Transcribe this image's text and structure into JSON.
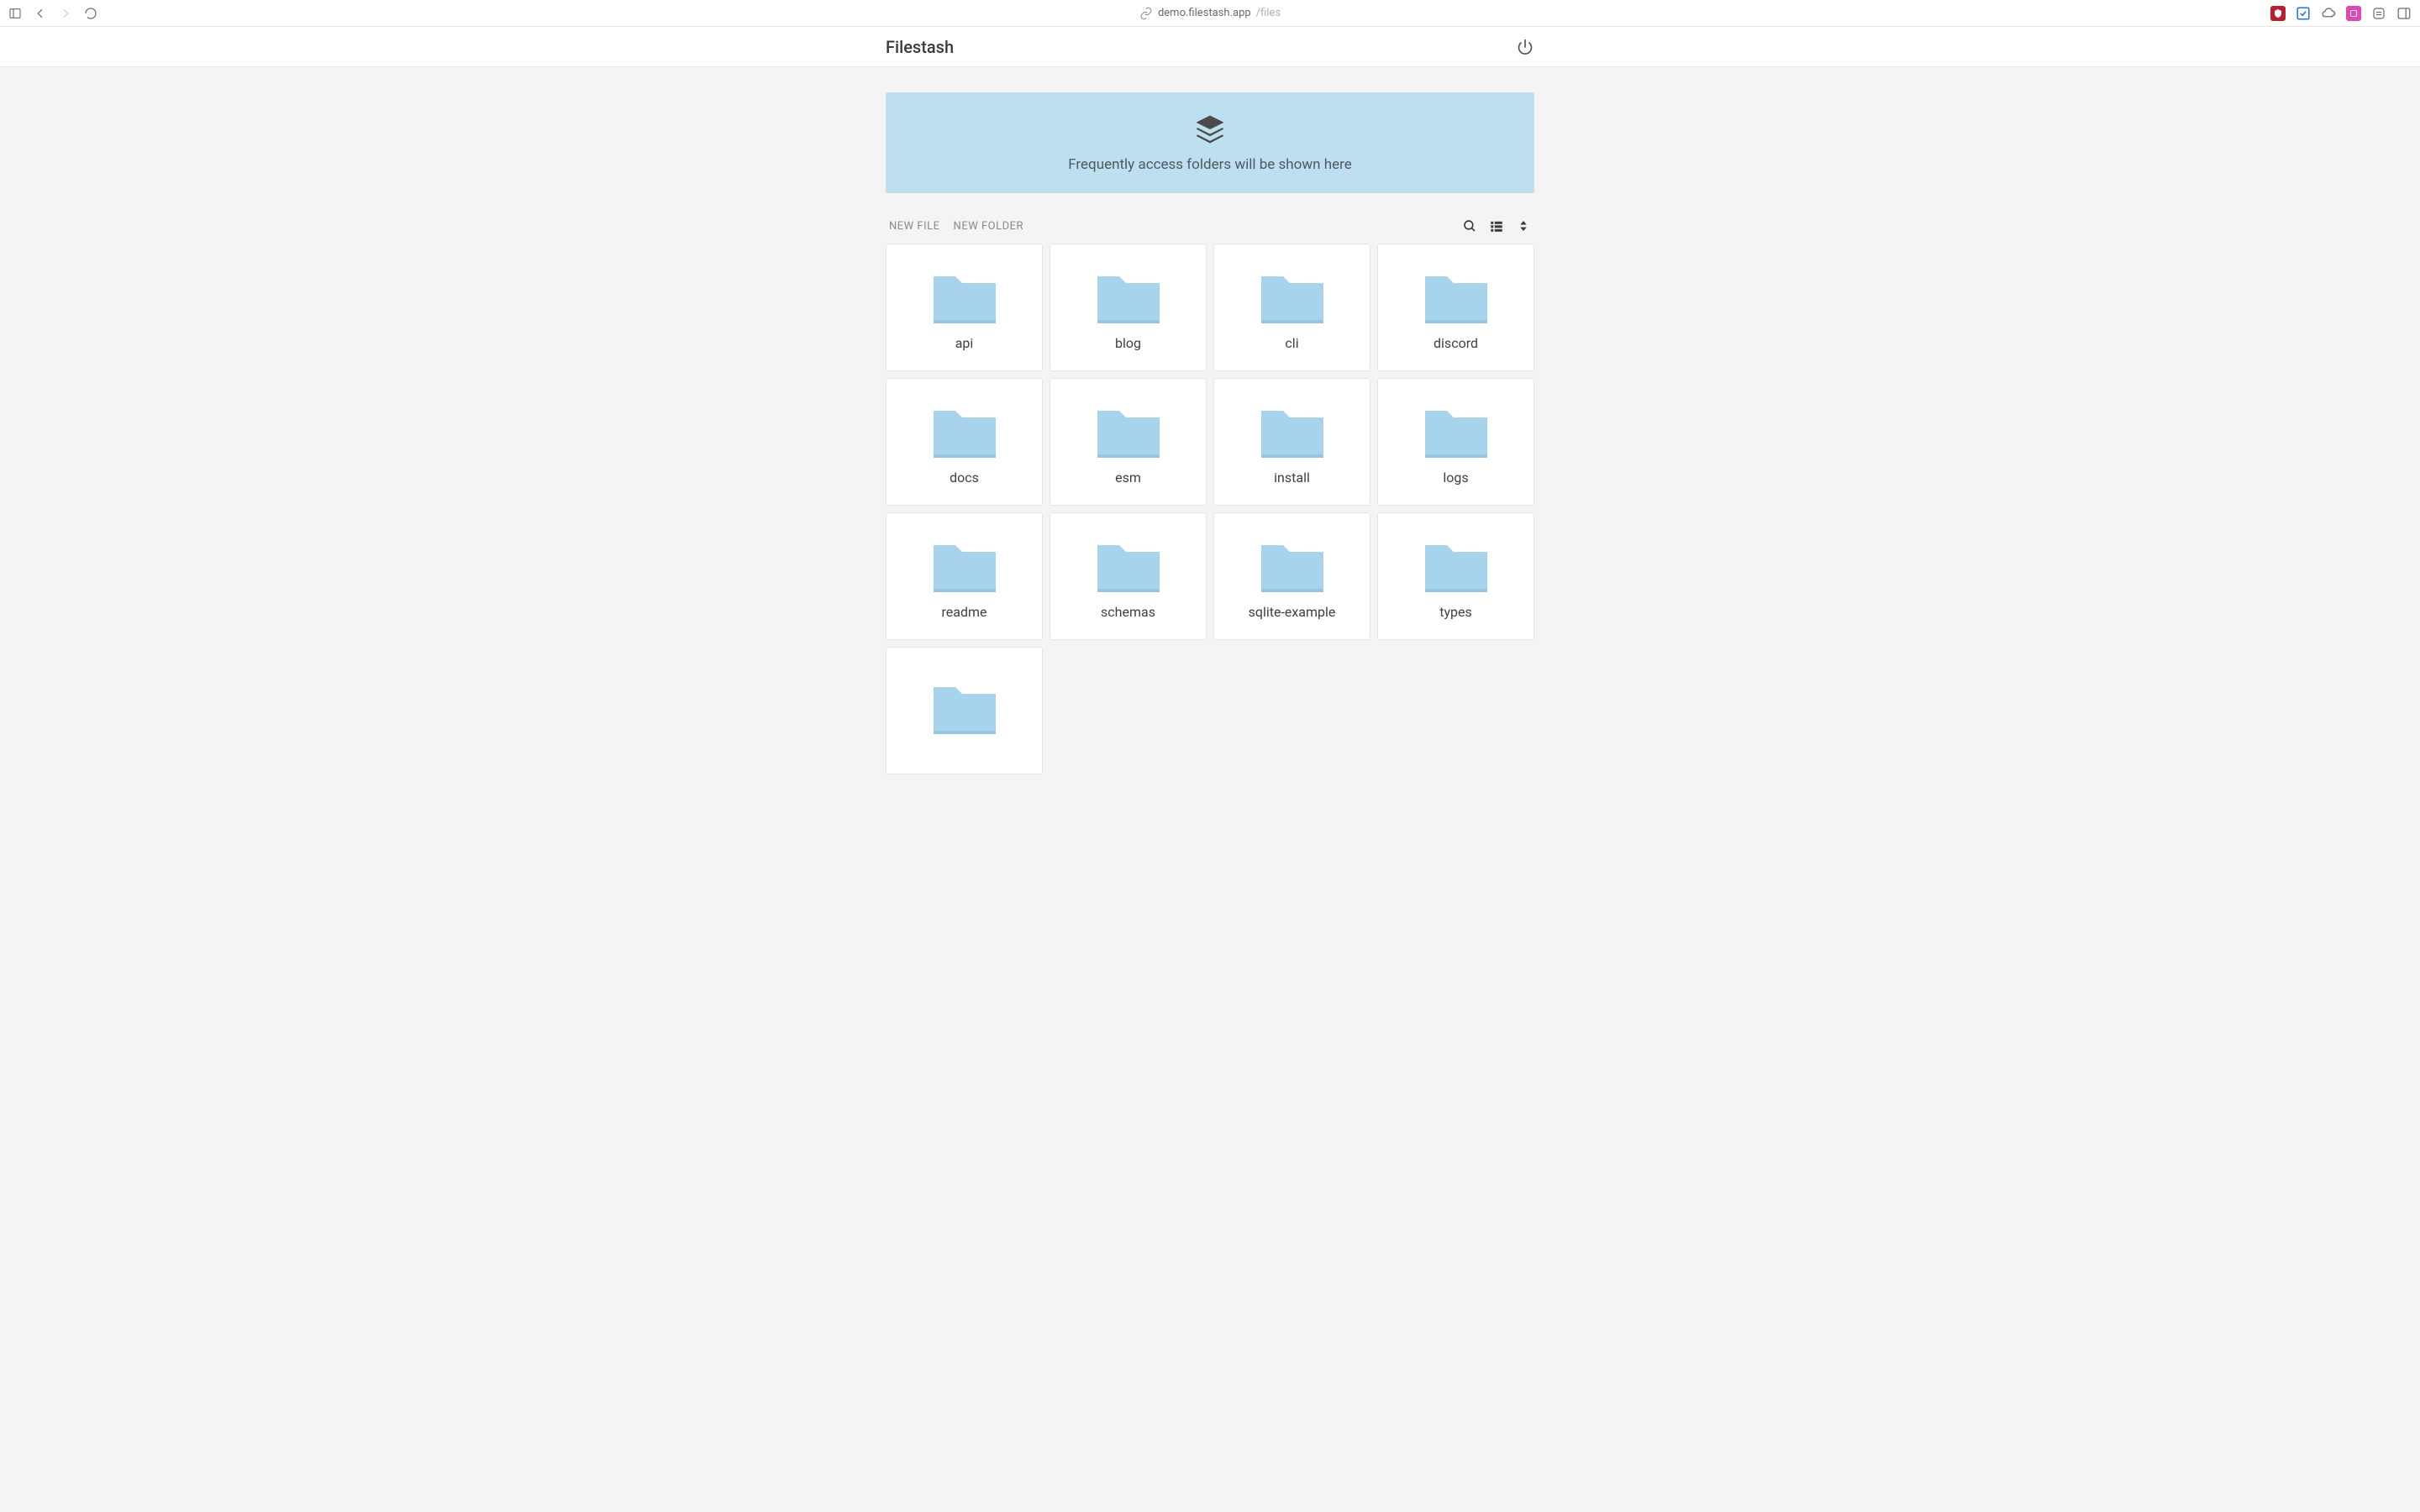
{
  "browser": {
    "url_host": "demo.filestash.app",
    "url_path": "/files"
  },
  "header": {
    "title": "Filestash"
  },
  "banner": {
    "text": "Frequently access folders will be shown here"
  },
  "toolbar": {
    "new_file_label": "NEW FILE",
    "new_folder_label": "NEW FOLDER"
  },
  "folders": [
    {
      "name": "api"
    },
    {
      "name": "blog"
    },
    {
      "name": "cli"
    },
    {
      "name": "discord"
    },
    {
      "name": "docs"
    },
    {
      "name": "esm"
    },
    {
      "name": "install"
    },
    {
      "name": "logs"
    },
    {
      "name": "readme"
    },
    {
      "name": "schemas"
    },
    {
      "name": "sqlite-example"
    },
    {
      "name": "types"
    },
    {
      "name": ""
    }
  ]
}
